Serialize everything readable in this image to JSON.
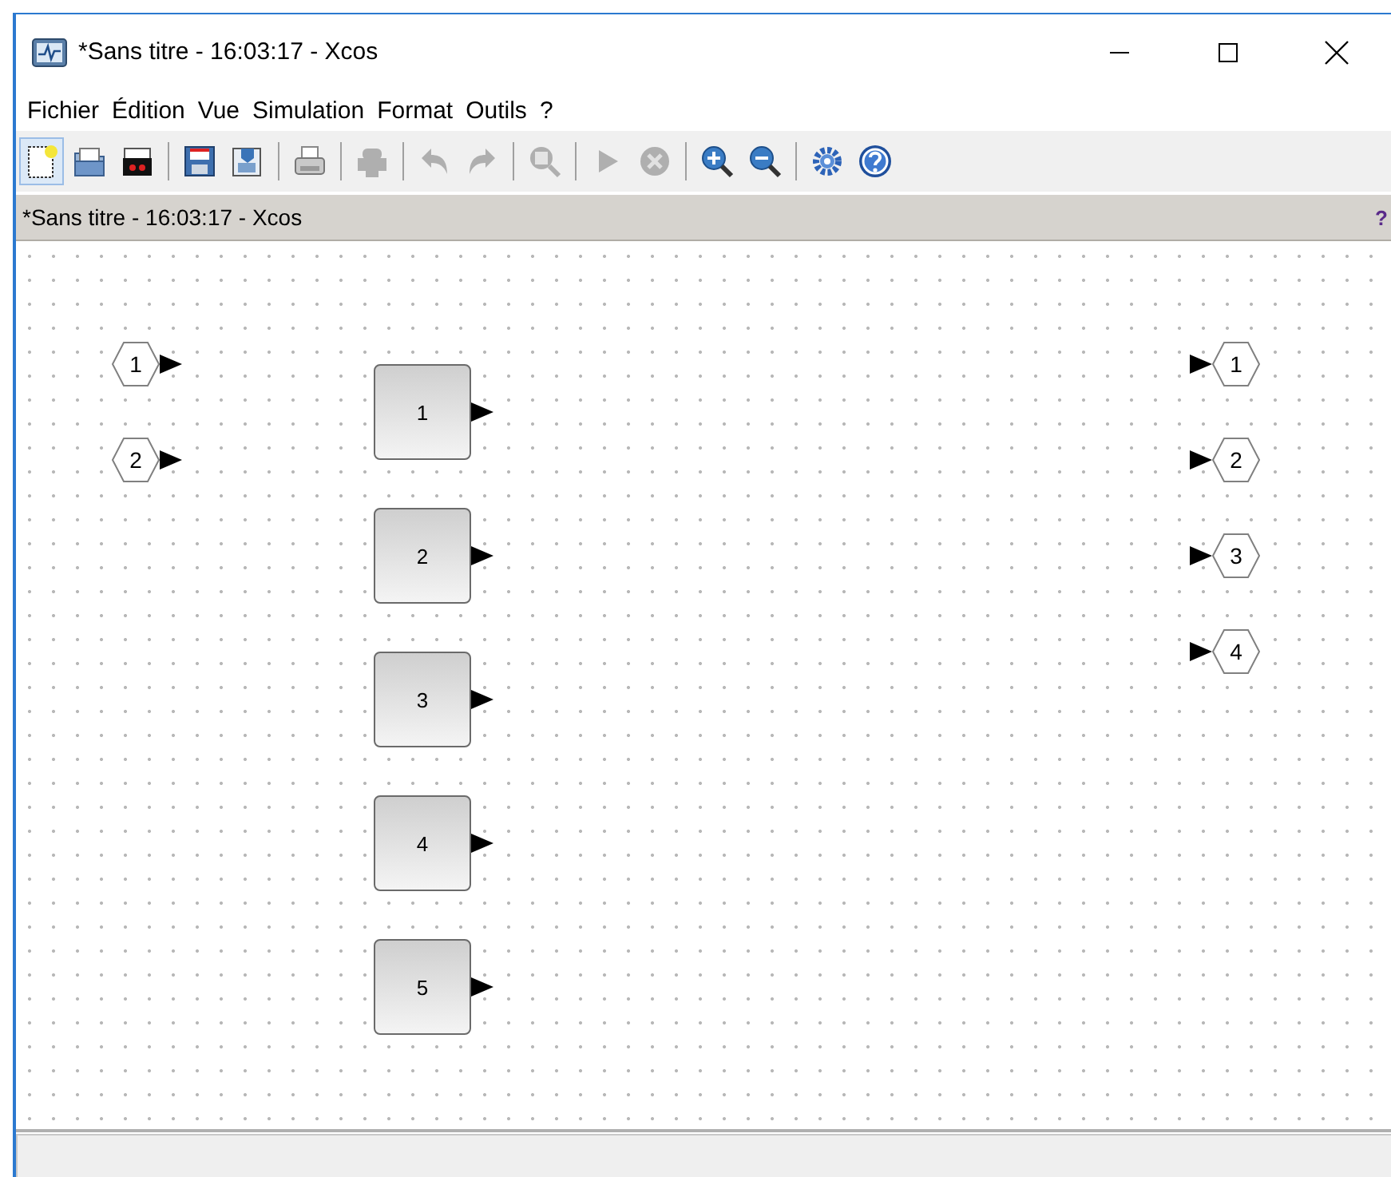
{
  "window": {
    "title": "*Sans titre - 16:03:17 - Xcos"
  },
  "menu": [
    "Fichier",
    "Édition",
    "Vue",
    "Simulation",
    "Format",
    "Outils",
    "?"
  ],
  "toolbar": [
    {
      "kind": "new",
      "disabled": false
    },
    {
      "kind": "open",
      "disabled": false
    },
    {
      "kind": "open-scilab",
      "disabled": false
    },
    {
      "kind": "separator"
    },
    {
      "kind": "save",
      "disabled": false
    },
    {
      "kind": "save-as",
      "disabled": false
    },
    {
      "kind": "separator"
    },
    {
      "kind": "print",
      "disabled": false
    },
    {
      "kind": "separator"
    },
    {
      "kind": "export",
      "disabled": true
    },
    {
      "kind": "separator"
    },
    {
      "kind": "undo",
      "disabled": true
    },
    {
      "kind": "redo",
      "disabled": true
    },
    {
      "kind": "separator"
    },
    {
      "kind": "zoom-fit",
      "disabled": true
    },
    {
      "kind": "separator"
    },
    {
      "kind": "start",
      "disabled": true
    },
    {
      "kind": "stop",
      "disabled": true
    },
    {
      "kind": "separator"
    },
    {
      "kind": "zoom-in",
      "disabled": false
    },
    {
      "kind": "zoom-out",
      "disabled": false
    },
    {
      "kind": "separator"
    },
    {
      "kind": "settings",
      "disabled": false
    },
    {
      "kind": "help",
      "disabled": false
    }
  ],
  "document_bar": {
    "title": "*Sans titre - 16:03:17 - Xcos",
    "help": "?"
  },
  "diagram": {
    "input_ports": [
      {
        "label": "1"
      },
      {
        "label": "2"
      }
    ],
    "blocks": [
      {
        "label": "1"
      },
      {
        "label": "2"
      },
      {
        "label": "3"
      },
      {
        "label": "4"
      },
      {
        "label": "5"
      }
    ],
    "output_ports": [
      {
        "label": "1"
      },
      {
        "label": "2"
      },
      {
        "label": "3"
      },
      {
        "label": "4"
      }
    ]
  }
}
